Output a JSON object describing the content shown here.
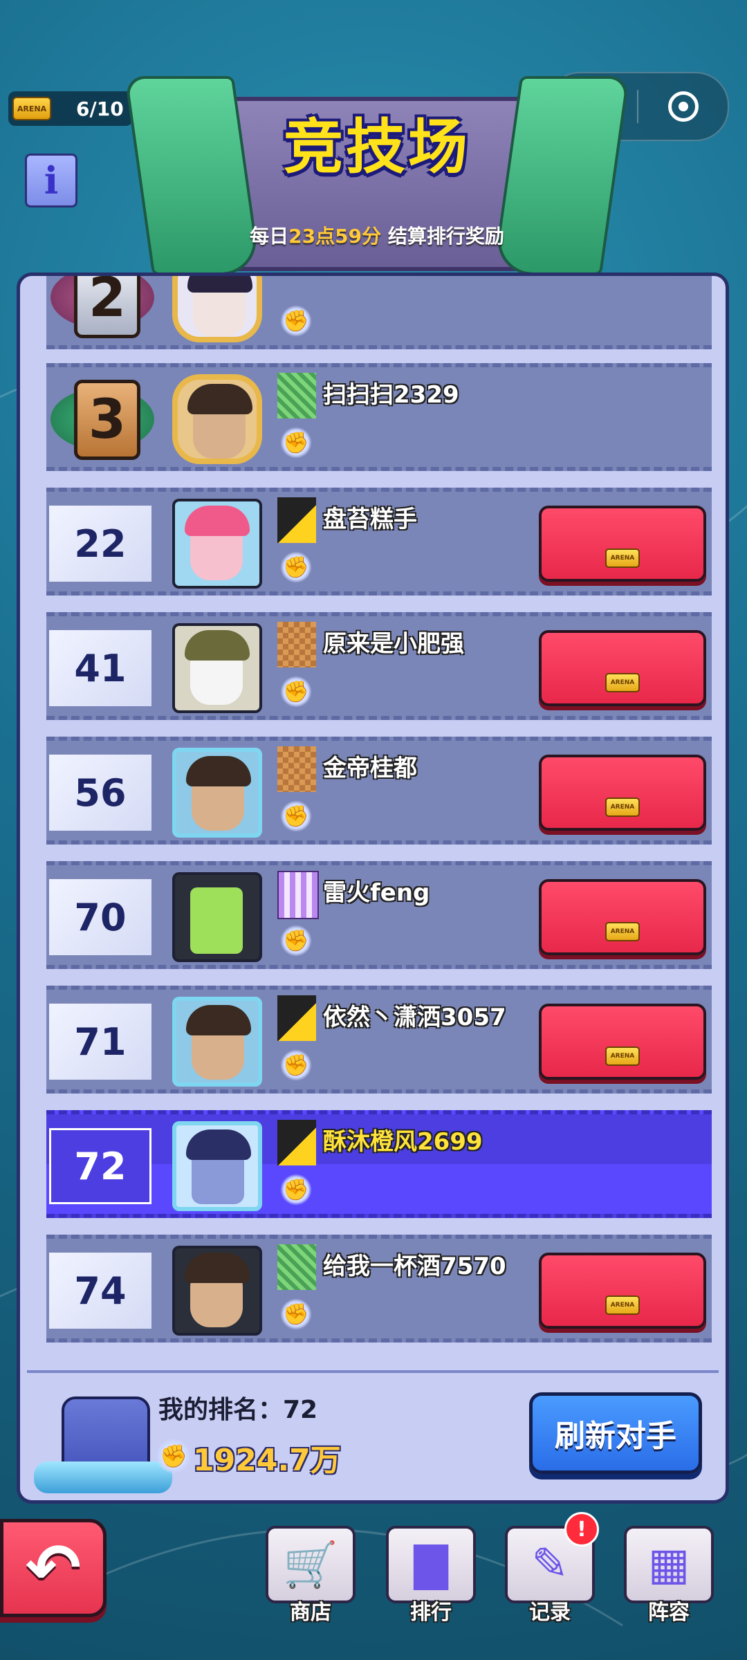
{
  "header": {
    "tickets": "6/10",
    "ticket_icon_label": "ARENA",
    "info_label": "i",
    "title": "竞技场",
    "subtitle_prefix": "每日",
    "subtitle_hour": "23点",
    "subtitle_minute": "59分",
    "subtitle_suffix": "结算排行奖励"
  },
  "colors": {
    "challenge_button": "#e8284a",
    "refresh_button": "#2a6de8",
    "self_row": "#4c3ee0",
    "power_text": "#ffc93a"
  },
  "players": [
    {
      "rank": "2",
      "name": "",
      "top3": true,
      "flag": "purple",
      "challenge": false
    },
    {
      "rank": "3",
      "name": "扫扫扫2329",
      "top3": true,
      "flag": "green",
      "challenge": false
    },
    {
      "rank": "22",
      "name": "盘苔糕手",
      "flag": "yellow",
      "challenge": true
    },
    {
      "rank": "41",
      "name": "原来是小肥强",
      "flag": "brown",
      "challenge": true
    },
    {
      "rank": "56",
      "name": "金帝桂都",
      "flag": "brown",
      "challenge": true
    },
    {
      "rank": "70",
      "name": "雷火feng",
      "flag": "purple",
      "challenge": true
    },
    {
      "rank": "71",
      "name": "依然丶潇洒3057",
      "flag": "yellow",
      "challenge": true
    },
    {
      "rank": "72",
      "name": "酥沐橙风2699",
      "flag": "yellow",
      "challenge": false,
      "self": true
    },
    {
      "rank": "74",
      "name": "给我一杯酒7570",
      "flag": "green",
      "challenge": true
    }
  ],
  "my_info": {
    "rank_text": "我的排名：72",
    "power": "1924.7万"
  },
  "buttons": {
    "refresh": "刷新对手",
    "challenge_ticket": "ARENA"
  },
  "nav": {
    "shop": "商店",
    "ranking": "排行",
    "records": "记录",
    "lineup": "阵容",
    "records_badge": "!"
  }
}
